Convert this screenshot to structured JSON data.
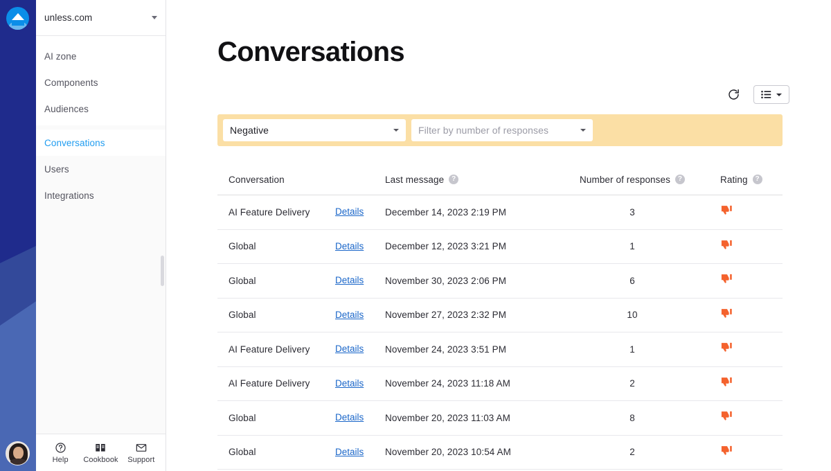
{
  "rail": {
    "logo_icon": "unless-logo-icon",
    "avatar_alt": "user-avatar"
  },
  "sidebar": {
    "workspace": {
      "name": "unless.com",
      "caret_icon": "chevron-down-icon"
    },
    "nav_top": [
      {
        "label": "AI zone",
        "id": "ai-zone",
        "active": false
      },
      {
        "label": "Components",
        "id": "components",
        "active": false
      },
      {
        "label": "Audiences",
        "id": "audiences",
        "active": false
      }
    ],
    "nav_bottom": [
      {
        "label": "Conversations",
        "id": "conversations",
        "active": true
      },
      {
        "label": "Users",
        "id": "users",
        "active": false
      },
      {
        "label": "Integrations",
        "id": "integrations",
        "active": false
      }
    ],
    "footer": [
      {
        "label": "Help",
        "icon": "question-circle-icon"
      },
      {
        "label": "Cookbook",
        "icon": "book-icon"
      },
      {
        "label": "Support",
        "icon": "envelope-icon"
      }
    ],
    "active_color": "#1f9cf0"
  },
  "header": {
    "title": "Conversations"
  },
  "toolbar": {
    "refresh_icon": "refresh-icon",
    "view_icon": "list-view-icon",
    "view_caret_icon": "chevron-down-icon"
  },
  "filters": {
    "background_color": "#fbdfa5",
    "rating": {
      "value": "Negative",
      "caret_icon": "chevron-down-icon"
    },
    "responses": {
      "value": "",
      "placeholder": "Filter by number of responses",
      "caret_icon": "chevron-down-icon"
    }
  },
  "table": {
    "columns": [
      {
        "label": "Conversation",
        "help": false
      },
      {
        "label": "",
        "help": false
      },
      {
        "label": "Last message",
        "help": true
      },
      {
        "label": "Number of responses",
        "help": true
      },
      {
        "label": "Rating",
        "help": true
      }
    ],
    "help_glyph": "?",
    "details_label": "Details",
    "rating_icon": "thumbs-down-icon",
    "rating_color": "#f4622d",
    "rows": [
      {
        "conversation": "AI Feature Delivery",
        "details": "Details",
        "last_message": "December 14, 2023 2:19 PM",
        "responses": "3",
        "rating": "thumbs-down"
      },
      {
        "conversation": "Global",
        "details": "Details",
        "last_message": "December 12, 2023 3:21 PM",
        "responses": "1",
        "rating": "thumbs-down"
      },
      {
        "conversation": "Global",
        "details": "Details",
        "last_message": "November 30, 2023 2:06 PM",
        "responses": "6",
        "rating": "thumbs-down"
      },
      {
        "conversation": "Global",
        "details": "Details",
        "last_message": "November 27, 2023 2:32 PM",
        "responses": "10",
        "rating": "thumbs-down"
      },
      {
        "conversation": "AI Feature Delivery",
        "details": "Details",
        "last_message": "November 24, 2023 3:51 PM",
        "responses": "1",
        "rating": "thumbs-down"
      },
      {
        "conversation": "AI Feature Delivery",
        "details": "Details",
        "last_message": "November 24, 2023 11:18 AM",
        "responses": "2",
        "rating": "thumbs-down"
      },
      {
        "conversation": "Global",
        "details": "Details",
        "last_message": "November 20, 2023 11:03 AM",
        "responses": "8",
        "rating": "thumbs-down"
      },
      {
        "conversation": "Global",
        "details": "Details",
        "last_message": "November 20, 2023 10:54 AM",
        "responses": "2",
        "rating": "thumbs-down"
      }
    ]
  }
}
